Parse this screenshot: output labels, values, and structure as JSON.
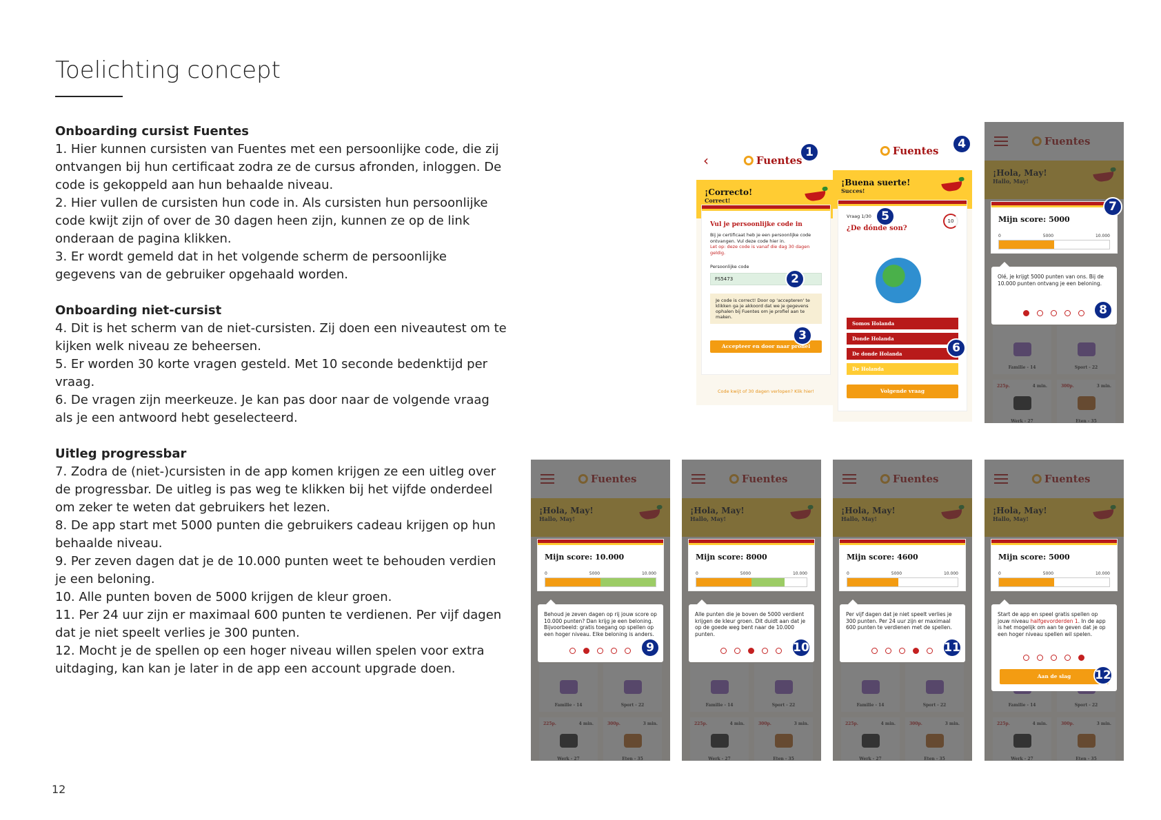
{
  "page": {
    "title": "Toelichting concept",
    "number": "12"
  },
  "sections": [
    {
      "heading": "Onboarding cursist Fuentes",
      "paragraphs": [
        "1. Hier kunnen cursisten van Fuentes met een persoonlijke code, die zij ontvangen bij hun certificaat zodra ze de cursus afronden, inloggen. De code is gekoppeld aan hun behaalde niveau.",
        "2. Hier vullen de cursisten hun code in. Als cursisten hun persoonlijke code kwijt zijn of over de 30 dagen heen zijn, kunnen ze op de link onderaan de pagina klikken.",
        "3. Er wordt gemeld dat in het volgende scherm de persoonlijke gegevens van de gebruiker opgehaald worden."
      ]
    },
    {
      "heading": "Onboarding niet-cursist",
      "paragraphs": [
        "4. Dit is het scherm van de niet-cursisten. Zij doen een niveautest om te kijken welk niveau ze beheersen.",
        "5. Er worden 30 korte vragen gesteld. Met 10 seconde bedenktijd per vraag.",
        "6. De vragen zijn meerkeuze. Je kan pas door naar de volgende vraag als je een antwoord hebt geselecteerd."
      ]
    },
    {
      "heading": "Uitleg progressbar",
      "paragraphs": [
        "7. Zodra de (niet-)cursisten in de app komen krijgen ze een uitleg over de progressbar. De uitleg is pas weg te klikken bij het vijfde onderdeel om zeker te weten dat gebruikers het lezen.",
        "8. De app start met 5000 punten die gebruikers cadeau krijgen op hun behaalde niveau.",
        "9. Per zeven dagen dat je de 10.000 punten weet te behouden verdien je een beloning.",
        "10. Alle punten boven de 5000 krijgen de kleur groen.",
        "11. Per 24 uur zijn er maximaal 600 punten te verdienen. Per vijf dagen dat je niet speelt verlies je 300 punten.",
        "12. Mocht je de spellen op een hoger niveau willen spelen voor extra uitdaging, kan kan je later in de app een account upgrade doen."
      ]
    }
  ],
  "app": {
    "brand": "Fuentes",
    "colors": {
      "red": "#b81a1a",
      "yellow": "#ffcc33",
      "orange": "#f39c12",
      "green": "#9ccc65",
      "badge": "#0c2a8a"
    },
    "screen1": {
      "banner_title": "¡Correcto!",
      "banner_sub": "Correct!",
      "card_title": "Vul je persoonlijke code in",
      "card_text": "Bij je certificaat heb je een persoonlijke code ontvangen. Vul deze code hier in.",
      "card_warning": "Let op: deze code is vanaf die dag 30 dagen geldig.",
      "field_label": "Persoonlijke code",
      "field_value": "FS5473",
      "notice": "Je code is correct! Door op 'accepteren' te klikken ga je akkoord dat we je gegevens ophalen bij Fuentes om je profiel aan te maken.",
      "button": "Accepteer en door naar profiel",
      "link": "Code kwijt of 30 dagen verlopen? Klik hier!"
    },
    "screen2": {
      "banner_title": "¡Buena suerte!",
      "banner_sub": "Succes!",
      "counter": "Vraag 1/30",
      "timer": "10",
      "question": "¿De dónde son?",
      "answers": [
        "Somos Holanda",
        "Donde Holanda",
        "De donde Holanda",
        "De Holanda"
      ],
      "button": "Volgende vraag"
    },
    "home": {
      "banner_title": "¡Hola, May!",
      "banner_sub": "Hallo, May!",
      "ticks": [
        "0",
        "5000",
        "10.000"
      ],
      "tiles": [
        {
          "label": "Familie - 14"
        },
        {
          "label": "Sport - 22"
        },
        {
          "points": "225p.",
          "time": "4 min.",
          "label": "Werk - 27"
        },
        {
          "points": "300p.",
          "time": "3 min.",
          "label": "Eten - 35"
        }
      ]
    },
    "tips": [
      {
        "score": "Mijn score: 5000",
        "score_value": 5000,
        "text": "Olé, je krijgt 5000 punten van ons. Bij de 10.000 punten ontvang je een beloning.",
        "active_dot": 0
      },
      {
        "score": "Mijn score: 10.000",
        "score_value": 10000,
        "text": "Behoud je zeven dagen op rij jouw score op 10.000 punten? Dan krijg je een beloning. Bijvoorbeeld: gratis toegang op spellen op een hoger niveau. Elke beloning is anders.",
        "active_dot": 1
      },
      {
        "score": "Mijn score: 8000",
        "score_value": 8000,
        "text": "Alle punten die je boven de 5000 verdient krijgen de kleur groen. Dit duidt aan dat je op de goede weg bent naar de 10.000 punten.",
        "active_dot": 2
      },
      {
        "score": "Mijn score: 4600",
        "score_value": 4600,
        "text": "Per vijf dagen dat je niet speelt verlies je 300 punten. Per 24 uur zijn er maximaal 600 punten te verdienen met de spellen.",
        "active_dot": 3
      },
      {
        "score": "Mijn score: 5000",
        "score_value": 5000,
        "text_before": "Start de app en speel gratis spellen op jouw niveau ",
        "text_highlight": "halfgevorderden 1",
        "text_after": ". In de app is het mogelijk om aan te geven dat je op een hoger niveau spellen wil spelen.",
        "active_dot": 4,
        "button": "Aan de slag"
      }
    ],
    "badges": [
      "1",
      "2",
      "3",
      "4",
      "5",
      "6",
      "7",
      "8",
      "9",
      "10",
      "11",
      "12"
    ]
  }
}
